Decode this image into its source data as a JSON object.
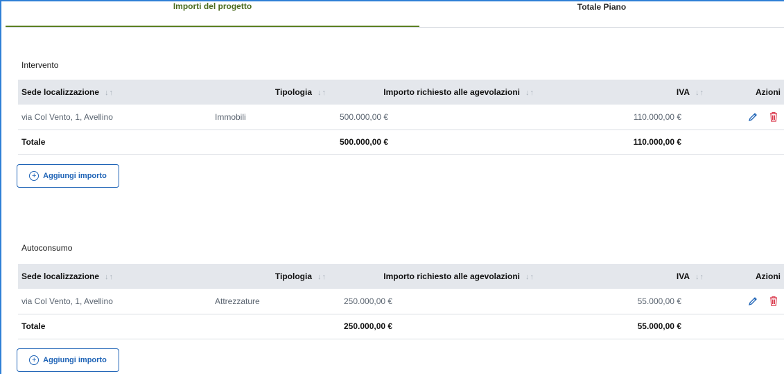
{
  "tabs": [
    {
      "label": "Importi del progetto",
      "active": true
    },
    {
      "label": "Totale Piano",
      "active": false
    }
  ],
  "columns": {
    "sede": "Sede localizzazione",
    "tipologia": "Tipologia",
    "importo": "Importo richiesto alle agevolazioni",
    "iva": "IVA",
    "azioni": "Azioni",
    "sort_glyph": "↓↑"
  },
  "sections": [
    {
      "title": "Intervento",
      "row": {
        "sede": "via Col Vento, 1, Avellino",
        "tipologia": "Immobili",
        "importo": "500.000,00 €",
        "iva": "110.000,00 €"
      },
      "total": {
        "label": "Totale",
        "importo": "500.000,00 €",
        "iva": "110.000,00 €"
      },
      "add_label": "Aggiungi importo"
    },
    {
      "title": "Autoconsumo",
      "row": {
        "sede": "via Col Vento, 1, Avellino",
        "tipologia": "Attrezzature",
        "importo": "250.000,00 €",
        "iva": "55.000,00 €"
      },
      "total": {
        "label": "Totale",
        "importo": "250.000,00 €",
        "iva": "55.000,00 €"
      },
      "add_label": "Aggiungi importo"
    }
  ],
  "icons": {
    "edit": "pencil-icon",
    "delete": "trash-icon",
    "add": "plus-circle-icon",
    "sort": "sort-arrows-icon"
  },
  "colors": {
    "accent_blue": "#1e63b6",
    "tab_active": "#5b7f21",
    "delete_red": "#d9364a",
    "header_bg": "#e4e7ec"
  }
}
